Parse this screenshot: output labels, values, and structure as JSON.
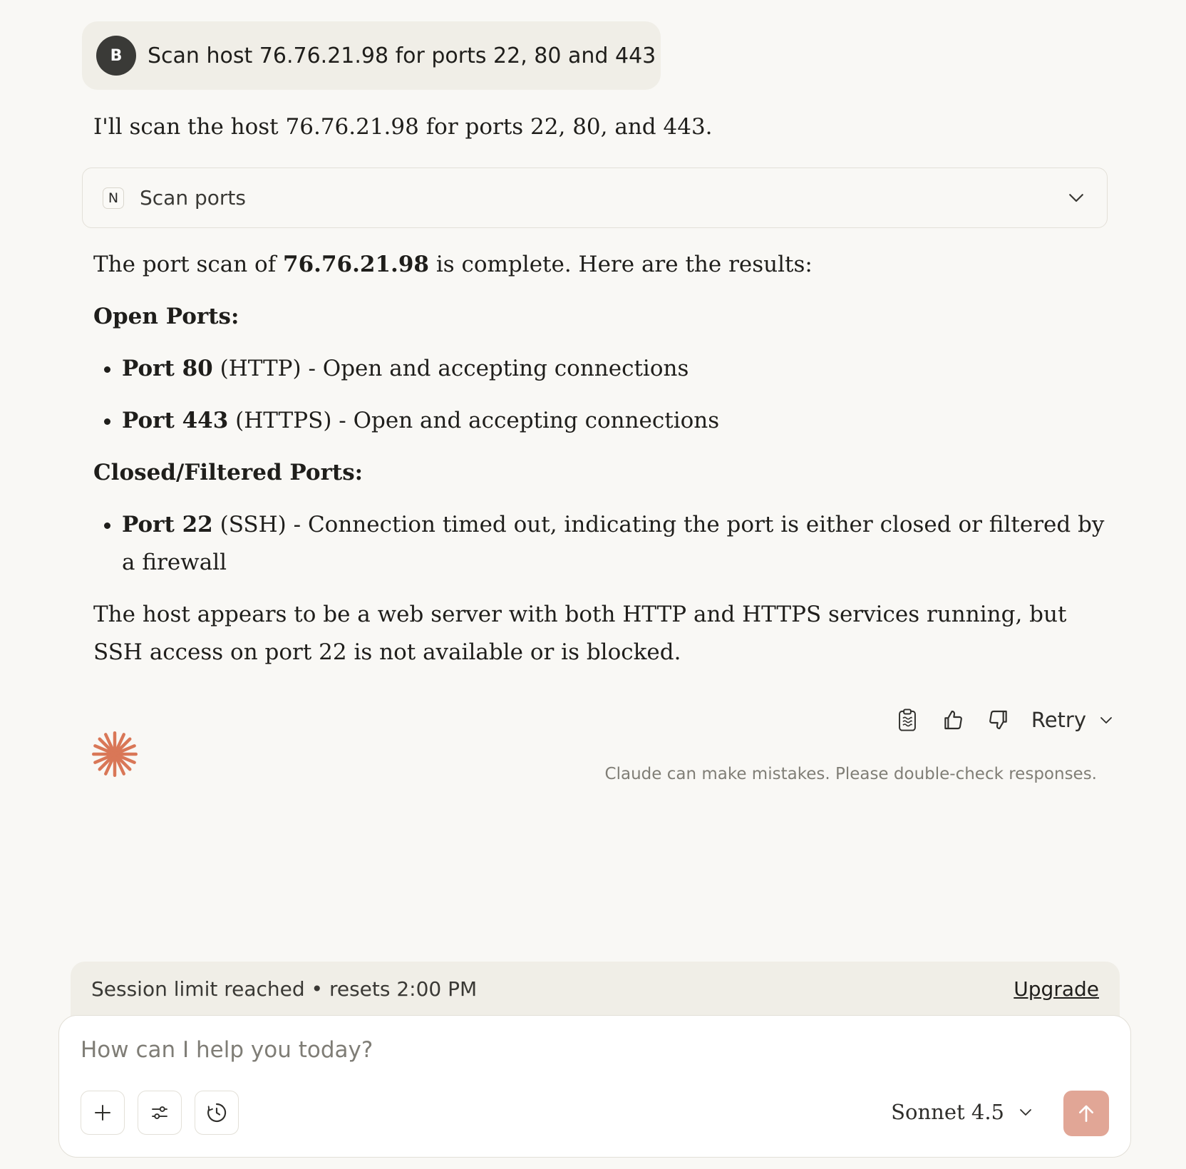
{
  "user_message": {
    "avatar_initial": "B",
    "text": "Scan host 76.76.21.98 for ports 22, 80 and 443"
  },
  "assistant": {
    "intro": "I'll scan the host 76.76.21.98 for ports 22, 80, and 443.",
    "tool_call": {
      "badge": "N",
      "name": "Scan ports",
      "chevron_icon": "chevron-down-icon"
    },
    "summary": {
      "prefix": "The port scan of ",
      "host": "76.76.21.98",
      "suffix": " is complete. Here are the results:"
    },
    "open_heading": "Open Ports:",
    "open_ports": [
      {
        "port": "Port 80",
        "desc": " (HTTP) - Open and accepting connections"
      },
      {
        "port": "Port 443",
        "desc": " (HTTPS) - Open and accepting connections"
      }
    ],
    "closed_heading": "Closed/Filtered Ports:",
    "closed_ports": [
      {
        "port": "Port 22",
        "desc": " (SSH) - Connection timed out, indicating the port is either closed or filtered by a firewall"
      }
    ],
    "conclusion": "The host appears to be a web server with both HTTP and HTTPS services running, but SSH access on port 22 is not available or is blocked."
  },
  "actions": {
    "retry_label": "Retry",
    "icons": [
      "copy-icon",
      "thumbs-up-icon",
      "thumbs-down-icon"
    ]
  },
  "disclaimer": "Claude can make mistakes. Please double-check responses.",
  "session_bar": {
    "text": "Session limit reached • resets 2:00 PM",
    "upgrade_label": "Upgrade"
  },
  "composer": {
    "placeholder": "How can I help you today?",
    "model": "Sonnet 4.5",
    "tool_icons": [
      "plus-icon",
      "sliders-icon",
      "clock-icon"
    ],
    "send_icon": "arrow-up-icon"
  },
  "colors": {
    "background": "#f9f8f5",
    "bubble": "#f0eee7",
    "brand": "#d97757",
    "send": "#e1a696"
  }
}
